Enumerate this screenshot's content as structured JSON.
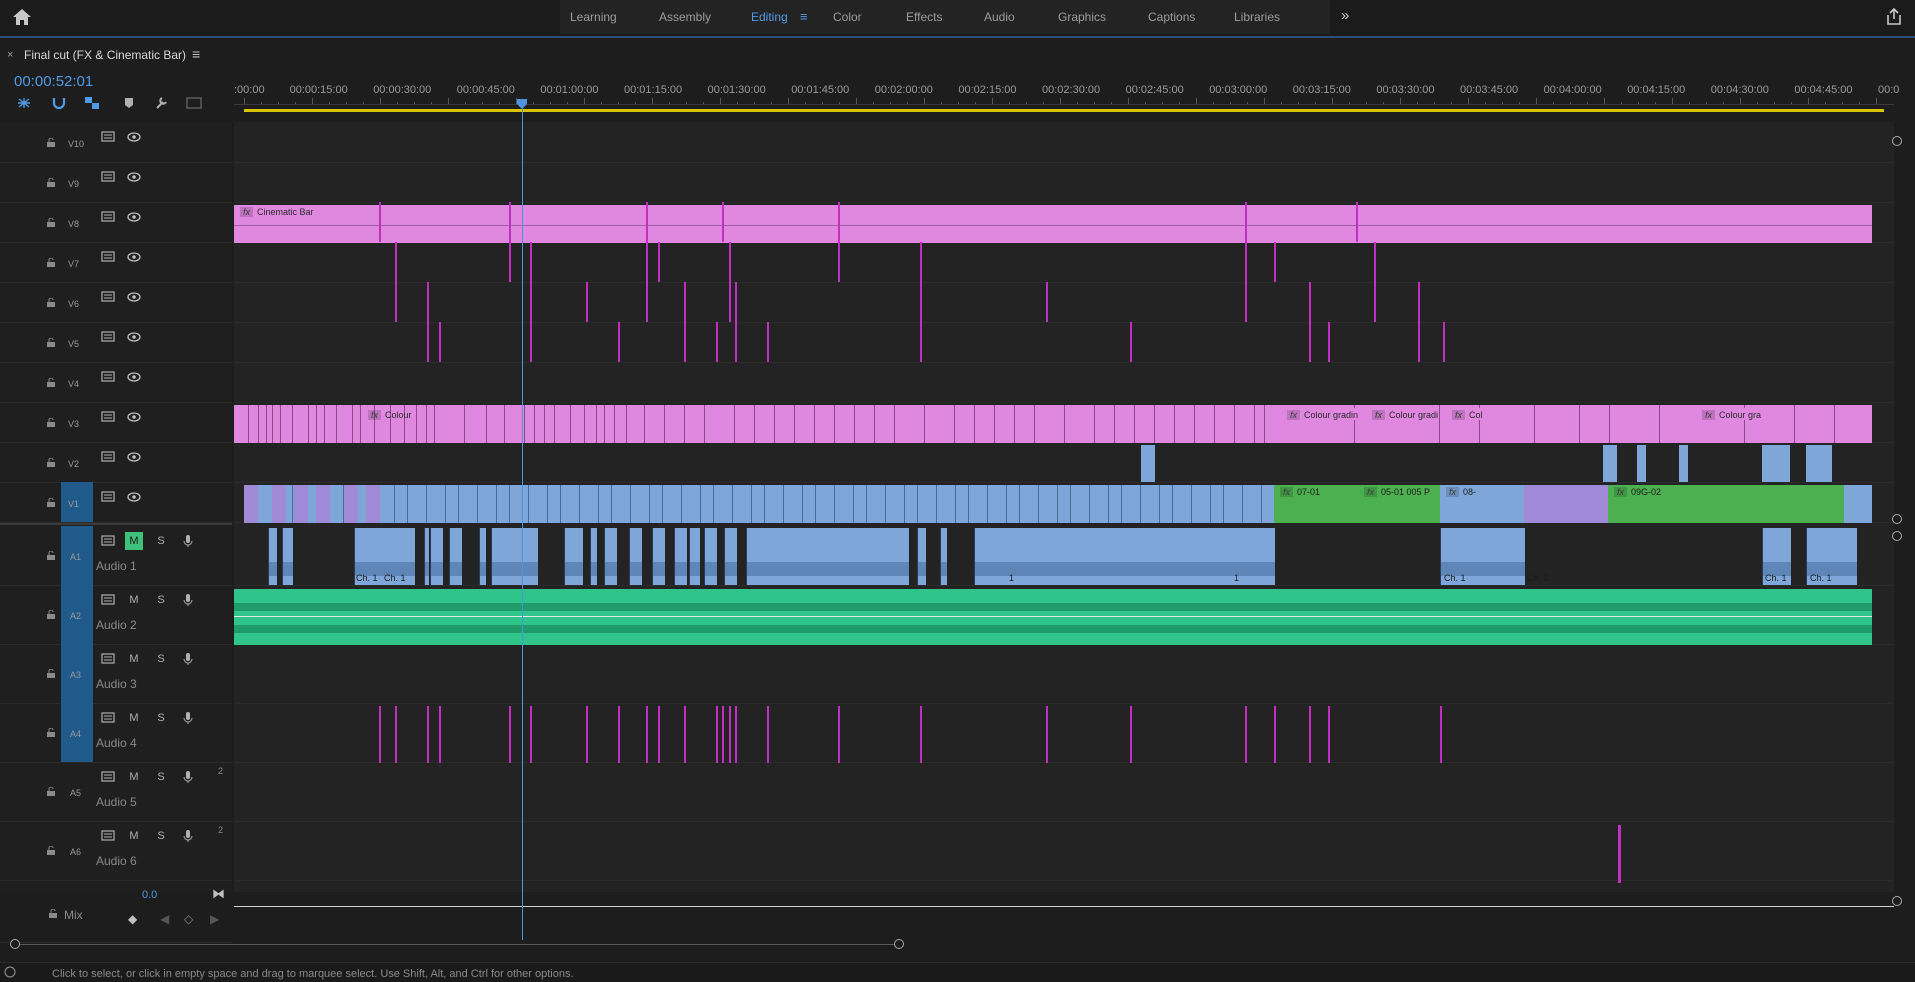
{
  "workspaces": [
    "Learning",
    "Assembly",
    "Editing",
    "Color",
    "Effects",
    "Audio",
    "Graphics",
    "Captions",
    "Libraries"
  ],
  "active_workspace": "Editing",
  "sequence": {
    "close_glyph": "×",
    "name": "Final cut  (FX & Cinematic Bar)",
    "menu_glyph": "≡"
  },
  "timecode": "00:00:52:01",
  "ruler_ticks": [
    ":00:00",
    "00:00:15:00",
    "00:00:30:00",
    "00:00:45:00",
    "00:01:00:00",
    "00:01:15:00",
    "00:01:30:00",
    "00:01:45:00",
    "00:02:00:00",
    "00:02:15:00",
    "00:02:30:00",
    "00:02:45:00",
    "00:03:00:00",
    "00:03:15:00",
    "00:03:30:00",
    "00:03:45:00",
    "00:04:00:00",
    "00:04:15:00",
    "00:04:30:00",
    "00:04:45:00",
    "00:0"
  ],
  "video_tracks": [
    "V10",
    "V9",
    "V8",
    "V7",
    "V6",
    "V5",
    "V4",
    "V3",
    "V2",
    "V1"
  ],
  "audio_tracks": [
    {
      "id": "A1",
      "name": "Audio 1",
      "extra": ""
    },
    {
      "id": "A2",
      "name": "Audio 2",
      "extra": ""
    },
    {
      "id": "A3",
      "name": "Audio 3",
      "extra": ""
    },
    {
      "id": "A4",
      "name": "Audio 4",
      "extra": ""
    },
    {
      "id": "A5",
      "name": "Audio 5",
      "extra": "2"
    },
    {
      "id": "A6",
      "name": "Audio 6",
      "extra": "2"
    }
  ],
  "mix": {
    "label": "Mix",
    "value": "0.0"
  },
  "audio_buttons": {
    "mute": "M",
    "solo": "S"
  },
  "clips": {
    "cinematic_bar": "Cinematic Bar",
    "v3_colour": "Colour",
    "v3_cg1": "Colour gradin",
    "v3_cg2": "Colour gradi",
    "v3_col": "Col",
    "v3_cg3": "Colour gra",
    "v1_c1": "07-01",
    "v1_c2": "05-01 005 P",
    "v1_c3": "08-",
    "v1_c4": "09G-02",
    "ch1": "Ch. 1",
    "one": "1",
    "fx": "fx"
  },
  "colors": {
    "magenta_clip": "#e088e0",
    "blue_clip": "#7ea6d8",
    "green_clip": "#4caf50",
    "audio_green": "#2fc58a",
    "accent": "#4f9ae6"
  },
  "status": "Click to select, or click in empty space and drag to marquee select. Use Shift, Alt, and Ctrl for other options."
}
